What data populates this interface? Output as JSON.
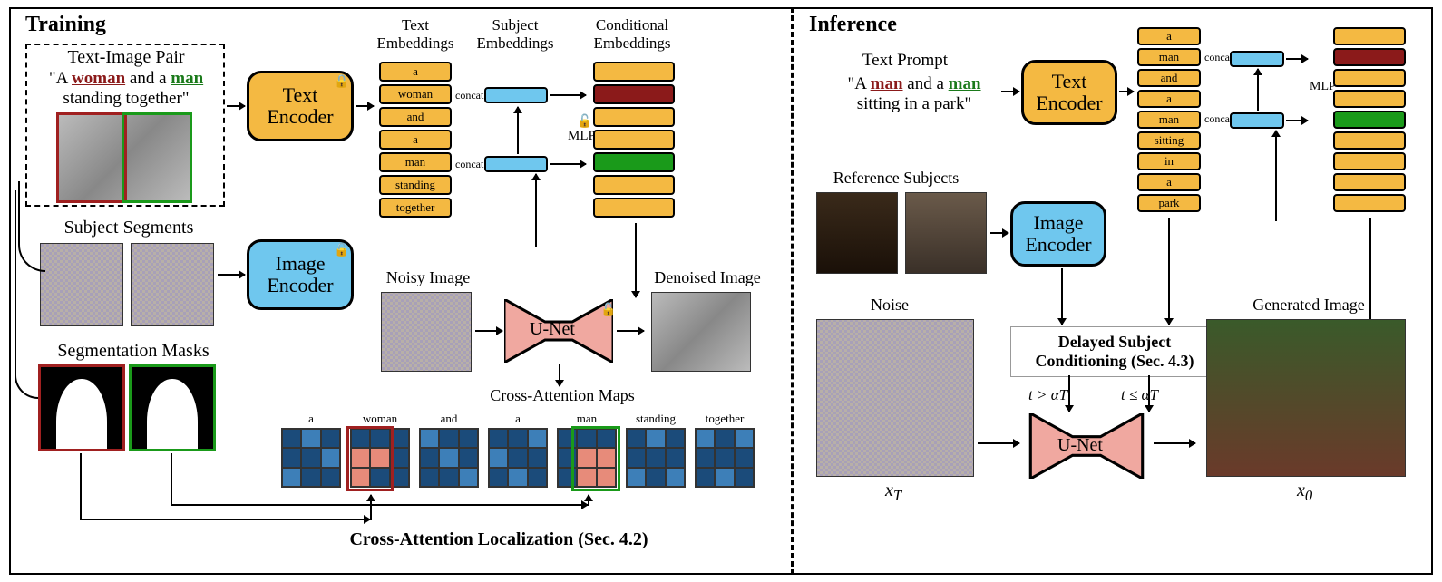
{
  "sections": {
    "training": "Training",
    "inference": "Inference"
  },
  "training": {
    "pair_label": "Text-Image Pair",
    "prompt_pre": "\"A ",
    "prompt_w": "woman",
    "prompt_mid": " and a ",
    "prompt_m": "man",
    "prompt_post": " standing together\"",
    "subject_segments": "Subject Segments",
    "seg_masks": "Segmentation Masks",
    "text_emb": "Text Embeddings",
    "subj_emb": "Subject Embeddings",
    "cond_emb": "Conditional Embeddings",
    "tokens": [
      "a",
      "woman",
      "and",
      "a",
      "man",
      "standing",
      "together"
    ],
    "text_encoder": "Text Encoder",
    "image_encoder": "Image Encoder",
    "mlp": "MLP",
    "concat": "concat.",
    "noisy": "Noisy Image",
    "denoised": "Denoised Image",
    "unet": "U-Net",
    "cam": "Cross-Attention Maps",
    "cal": "Cross-Attention Localization (Sec. 4.2)"
  },
  "inference": {
    "text_prompt": "Text Prompt",
    "prompt_pre": "\"A ",
    "prompt_m1": "man",
    "prompt_mid": " and a ",
    "prompt_m2": "man",
    "prompt_post": " sitting in a park\"",
    "ref_subj": "Reference Subjects",
    "tokens": [
      "a",
      "man",
      "and",
      "a",
      "man",
      "sitting",
      "in",
      "a",
      "park"
    ],
    "text_encoder": "Text Encoder",
    "image_encoder": "Image Encoder",
    "mlp": "MLP",
    "concat": "concat.",
    "noise": "Noise",
    "dsc": "Delayed Subject Conditioning (Sec. 4.3)",
    "cond1": "t > αT",
    "cond2": "t ≤ αT",
    "unet": "U-Net",
    "gen": "Generated Image",
    "xT": "x",
    "xT_sub": "T",
    "x0": "x",
    "x0_sub": "0"
  },
  "colors": {
    "red": "#8b1a1a",
    "green": "#1a7a1a",
    "orange": "#f4b942",
    "blue": "#6fc7ee",
    "pink": "#f0a8a0"
  }
}
